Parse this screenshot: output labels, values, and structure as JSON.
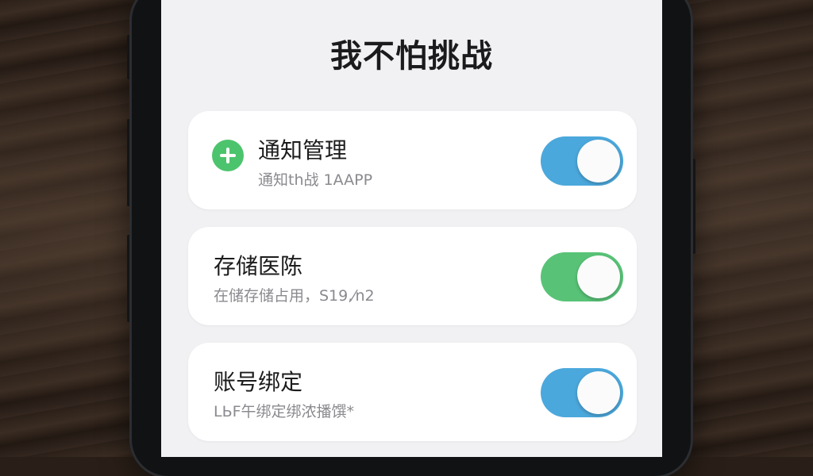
{
  "screen": {
    "title": "我不怕挑战"
  },
  "settings": [
    {
      "title": "通知管理",
      "subtitle": "通知th战 1AAPP",
      "icon": "plus-circle-icon",
      "icon_color": "#4cc46d",
      "toggle_on": true,
      "toggle_color": "#4ba8dc"
    },
    {
      "title": "存储医陈",
      "subtitle": "在储存储占用，S19,⁄n2",
      "toggle_on": true,
      "toggle_color": "#58c377"
    },
    {
      "title": "账号绑定",
      "subtitle": "LЬF午绑定绑浓播馔*",
      "toggle_on": true,
      "toggle_color": "#4ba8dc"
    }
  ]
}
